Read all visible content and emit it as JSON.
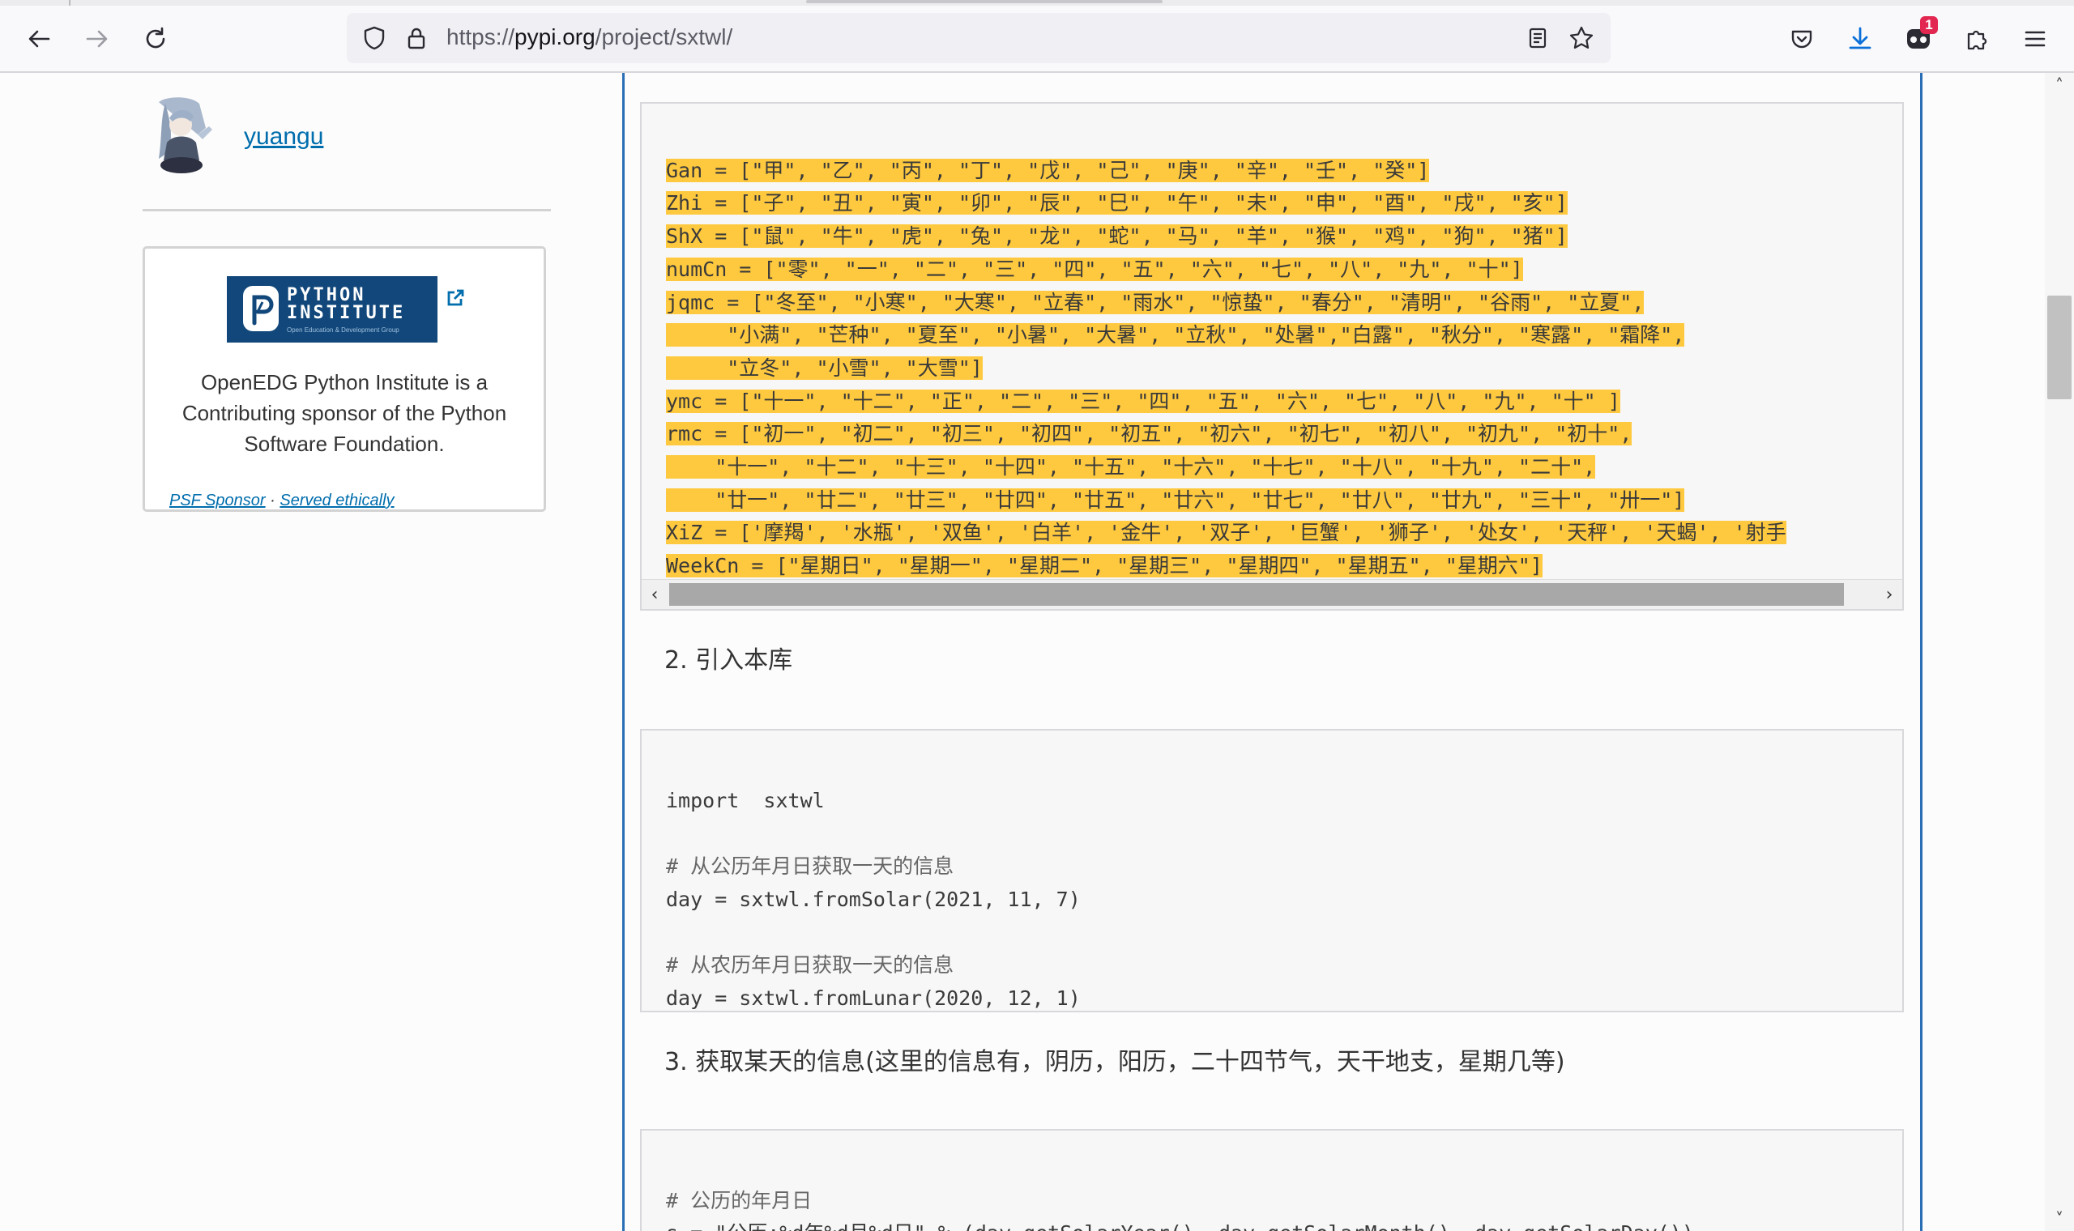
{
  "browser": {
    "url_prefix": "https://",
    "url_domain": "pypi.org",
    "url_path": "/project/sxtwl/",
    "extension_badge": "1"
  },
  "sidebar": {
    "maintainer_name": "yuangu",
    "sponsor_logo_line1": "PYTHON",
    "sponsor_logo_line2": "INSTITUTE",
    "sponsor_logo_tagline": "Open Education & Development Group",
    "sponsor_text": "OpenEDG Python Institute is a Contributing sponsor of the Python Software Foundation.",
    "psf_sponsor_link": "PSF Sponsor",
    "separator": " · ",
    "served_ethically_link": "Served ethically"
  },
  "code_block_1": {
    "lines": [
      "Gan = [\"甲\", \"乙\", \"丙\", \"丁\", \"戊\", \"己\", \"庚\", \"辛\", \"壬\", \"癸\"]",
      "Zhi = [\"子\", \"丑\", \"寅\", \"卯\", \"辰\", \"巳\", \"午\", \"未\", \"申\", \"酉\", \"戌\", \"亥\"]",
      "ShX = [\"鼠\", \"牛\", \"虎\", \"兔\", \"龙\", \"蛇\", \"马\", \"羊\", \"猴\", \"鸡\", \"狗\", \"猪\"]",
      "numCn = [\"零\", \"一\", \"二\", \"三\", \"四\", \"五\", \"六\", \"七\", \"八\", \"九\", \"十\"]",
      "jqmc = [\"冬至\", \"小寒\", \"大寒\", \"立春\", \"雨水\", \"惊蛰\", \"春分\", \"清明\", \"谷雨\", \"立夏\",",
      "     \"小满\", \"芒种\", \"夏至\", \"小暑\", \"大暑\", \"立秋\", \"处暑\",\"白露\", \"秋分\", \"寒露\", \"霜降\",",
      "     \"立冬\", \"小雪\", \"大雪\"]",
      "ymc = [\"十一\", \"十二\", \"正\", \"二\", \"三\", \"四\", \"五\", \"六\", \"七\", \"八\", \"九\", \"十\" ]",
      "rmc = [\"初一\", \"初二\", \"初三\", \"初四\", \"初五\", \"初六\", \"初七\", \"初八\", \"初九\", \"初十\",",
      "    \"十一\", \"十二\", \"十三\", \"十四\", \"十五\", \"十六\", \"十七\", \"十八\", \"十九\", \"二十\",",
      "    \"廿一\", \"廿二\", \"廿三\", \"廿四\", \"廿五\", \"廿六\", \"廿七\", \"廿八\", \"廿九\", \"三十\", \"卅一\"]",
      "XiZ = ['摩羯', '水瓶', '双鱼', '白羊', '金牛', '双子', '巨蟹', '狮子', '处女', '天秤', '天蝎', '射手",
      "WeekCn = [\"星期日\", \"星期一\", \"星期二\", \"星期三\", \"星期四\", \"星期五\", \"星期六\"]"
    ]
  },
  "heading_2": "2. 引入本库",
  "code_block_2": {
    "lines": [
      "import  sxtwl",
      "",
      "# 从公历年月日获取一天的信息",
      "day = sxtwl.fromSolar(2021, 11, 7)",
      "",
      "# 从农历年月日获取一天的信息",
      "day = sxtwl.fromLunar(2020, 12, 1)"
    ]
  },
  "heading_3": "3. 获取某天的信息(这里的信息有，阴历，阳历，二十四节气，天干地支，星期几等)",
  "code_block_3": {
    "lines": [
      "# 公历的年月日",
      "s = \"公历:%d年%d月%d日\" % (day.getSolarYear(), day.getSolarMonth(), day.getSolarDay())"
    ]
  },
  "colors": {
    "highlight": "#ffc93f",
    "link": "#006dad",
    "content_border": "#2a6fb5"
  }
}
